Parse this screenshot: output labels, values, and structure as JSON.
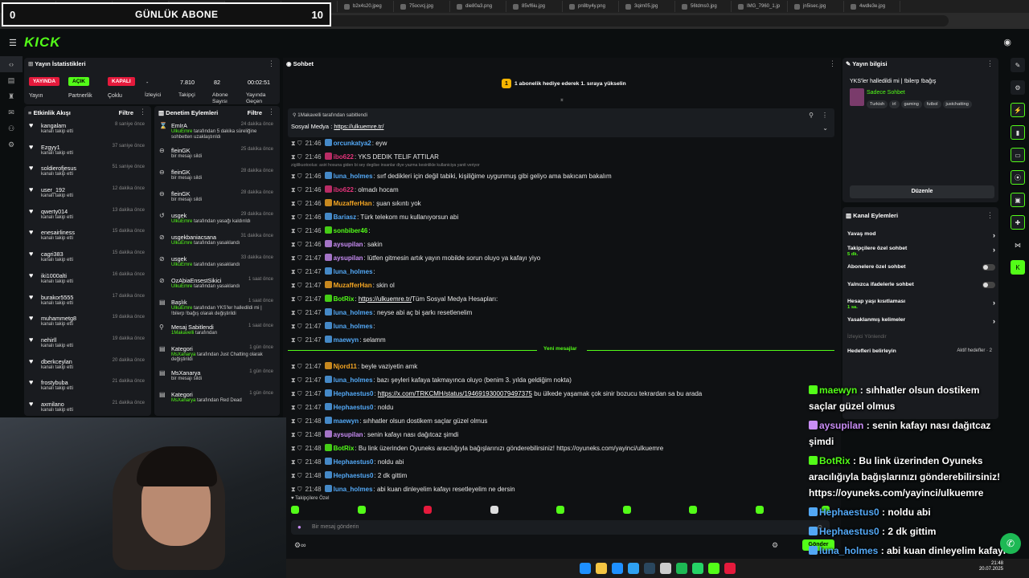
{
  "browser": {
    "tabs": [
      "Vakıflar Ho",
      "bacon i take",
      "KICKSTART",
      "Stream - Kick",
      "Screenshot By",
      "HİZMET",
      "b2x4s20.jpeg",
      "75ocvcj.jpg",
      "die80a3.png",
      "85vf6iu.jpg",
      "pn8by4y.png",
      "3qim05.jpg",
      "56tdms0.jpg",
      "IMG_7960_1.jp",
      "jn5isec.jpg",
      "4wdle3e.jpg"
    ],
    "url": "https://dashboard.kick.com/stream"
  },
  "overlay": {
    "sub_label": "GÜNLÜK ABONE",
    "sub_left": "0",
    "sub_right": "10"
  },
  "logo": "KICK",
  "stats": {
    "title": "Yayın İstatistikleri",
    "items": [
      {
        "pill": "YAYINDA",
        "label": "Yayın",
        "color": "#e51a3c"
      },
      {
        "pill": "AÇIK",
        "label": "Partnerlik",
        "color": "#53fc18"
      },
      {
        "pill": "KAPALI",
        "label": "Çoklu",
        "color": "#e51a3c"
      }
    ],
    "values": [
      {
        "value": "-",
        "label": "İzleyici"
      },
      {
        "value": "7.810",
        "label": "Takipçi"
      },
      {
        "value": "82",
        "label": "Abone Sayısı"
      },
      {
        "value": "00:02:51",
        "label": "Yayında Geçen"
      }
    ]
  },
  "activity": {
    "title": "Etkinlik Akışı",
    "filter": "Filtre",
    "items": [
      {
        "name": "kangalam",
        "sub": "kanalı takip etti",
        "time": "8 saniye önce"
      },
      {
        "name": "Ezgyy1",
        "sub": "kanalı takip etti",
        "time": "37 saniye önce"
      },
      {
        "name": "soldierofjesus",
        "sub": "kanalı takip etti",
        "time": "51 saniye önce"
      },
      {
        "name": "user_192",
        "sub": "kanalı takip etti",
        "time": "12 dakika önce"
      },
      {
        "name": "qwerty014",
        "sub": "kanalı takip etti",
        "time": "13 dakika önce"
      },
      {
        "name": "enesairliness",
        "sub": "kanalı takip etti",
        "time": "15 dakika önce"
      },
      {
        "name": "cagri383",
        "sub": "kanalı takip etti",
        "time": "15 dakika önce"
      },
      {
        "name": "iki1000alti",
        "sub": "kanalı takip etti",
        "time": "16 dakika önce"
      },
      {
        "name": "burakor5555",
        "sub": "kanalı takip etti",
        "time": "17 dakika önce"
      },
      {
        "name": "muhammetg8",
        "sub": "kanalı takip etti",
        "time": "19 dakika önce"
      },
      {
        "name": "nehirll",
        "sub": "kanalı takip etti",
        "time": "19 dakika önce"
      },
      {
        "name": "dberkceylan",
        "sub": "kanalı takip etti",
        "time": "20 dakika önce"
      },
      {
        "name": "frostybuba",
        "sub": "kanalı takip etti",
        "time": "21 dakika önce"
      },
      {
        "name": "axmilano",
        "sub": "kanalı takip etti",
        "time": "21 dakika önce"
      }
    ]
  },
  "modlog": {
    "title": "Denetim Eylemleri",
    "filter": "Filtre",
    "items": [
      {
        "icon": "⌛",
        "name": "EmIrA",
        "sub": "UlkuEmre tarafından 5 dakika süreliğine sohbetten uzaklaştırıldı",
        "time": "24 dakika önce"
      },
      {
        "icon": "⊖",
        "name": "fleinGK",
        "sub": "bir mesajı sildi",
        "time": "25 dakika önce"
      },
      {
        "icon": "⊖",
        "name": "fleinGK",
        "sub": "bir mesajı sildi",
        "time": "28 dakika önce"
      },
      {
        "icon": "⊖",
        "name": "fleinGK",
        "sub": "bir mesajı sildi",
        "time": "28 dakika önce"
      },
      {
        "icon": "↺",
        "name": "usgek",
        "sub": "UlkuEmre tarafından yasağı kaldırıldı",
        "time": "29 dakika önce"
      },
      {
        "icon": "⊘",
        "name": "usgekbaniacsana",
        "sub": "UlkuEmre tarafından yasaklandı",
        "time": "31 dakika önce"
      },
      {
        "icon": "⊘",
        "name": "usgek",
        "sub": "UlkuEmre tarafından yasaklandı",
        "time": "33 dakika önce"
      },
      {
        "icon": "⊘",
        "name": "OzAbiaEnsestSikici",
        "sub": "UlkuEmre tarafından yasaklandı",
        "time": "1 saat önce"
      },
      {
        "icon": "▤",
        "name": "Başlık",
        "sub": "UlkuEmre tarafından YKS'ler halledildi mi | !bilerp !bağış olarak değiştirildi",
        "time": "1 saat önce"
      },
      {
        "icon": "⚲",
        "name": "Mesaj Sabitlendi",
        "sub": "1Makavelli tarafından",
        "time": "1 saat önce"
      },
      {
        "icon": "▤",
        "name": "Kategori",
        "sub": "MsXanarya tarafından Just Chatting olarak değiştirildi",
        "time": "1 gün önce"
      },
      {
        "icon": "▤",
        "name": "MsXanarya",
        "sub": "bir mesajı sildi",
        "time": "1 gün önce"
      },
      {
        "icon": "▤",
        "name": "Kategori",
        "sub": "MsXanarya tarafından Red Dead",
        "time": "1 gün önce"
      }
    ]
  },
  "chat": {
    "title": "Sohbet",
    "goal": "1 abonelik hediye ederek 1. sıraya yükselin",
    "pinned_by": "1Makavelli tarafından sabitlendi",
    "pinned_text": "Sosyal Medya : ",
    "pinned_link": "https://ulkuemre.tr/",
    "new_messages": "Yeni mesajlar",
    "input_placeholder": "Bir mesaj gönderin",
    "send": "Gönder",
    "follower_only": "Takipçilere Özel",
    "messages": [
      {
        "time": "21:46",
        "user": "orcunkatya2",
        "color": "#53a8f5",
        "text": "eyw"
      },
      {
        "time": "21:46",
        "user": "ibo622",
        "color": "#e3337a",
        "text": "YKS DEDIK TELIF ATTILAR"
      },
      {
        "time": "21:46",
        "user": "luna_holmes",
        "color": "#53a8f5",
        "text": "sırf dedikleri için değil tabiki, kişiliğime uygunmuş gibi geliyo ama bakıcam bakalım"
      },
      {
        "time": "21:46",
        "user": "ibo622",
        "color": "#e3337a",
        "text": "olmadı hocam"
      },
      {
        "time": "21:46",
        "user": "MuzafferHan",
        "color": "#f5a623",
        "text": "şuan sıkıntı yok"
      },
      {
        "time": "21:46",
        "user": "Bariasz",
        "color": "#53a8f5",
        "text": "Türk telekom mu kullanıyorsun abi"
      },
      {
        "time": "21:46",
        "user": "sonbiber46",
        "color": "#53fc18",
        "text": ""
      },
      {
        "time": "21:46",
        "user": "aysupilan",
        "color": "#c98df5",
        "text": "sakin"
      },
      {
        "time": "21:47",
        "user": "aysupilan",
        "color": "#c98df5",
        "text": "lütfen gitmesin artık yayın mobilde sorun oluyo ya kafayı yiyo"
      },
      {
        "time": "21:47",
        "user": "luna_holmes",
        "color": "#53a8f5",
        "text": ""
      },
      {
        "time": "21:47",
        "user": "MuzafferHan",
        "color": "#f5a623",
        "text": "skin ol"
      },
      {
        "time": "21:47",
        "user": "BotRix",
        "color": "#53fc18",
        "text": "Tüm Sosyal Medya Hesapları: ",
        "link": "https://ulkuemre.tr/"
      },
      {
        "time": "21:47",
        "user": "luna_holmes",
        "color": "#53a8f5",
        "text": "neyse abi aç bi şarkı resetlenelim"
      },
      {
        "time": "21:47",
        "user": "luna_holmes",
        "color": "#53a8f5",
        "text": ""
      },
      {
        "time": "21:47",
        "user": "maewyn",
        "color": "#53a8f5",
        "text": "selamm"
      },
      {
        "time": "21:47",
        "user": "Njord11",
        "color": "#f5a623",
        "text": "beyle vaziyetin amk"
      },
      {
        "time": "21:47",
        "user": "luna_holmes",
        "color": "#53a8f5",
        "text": "bazı şeyleri kafaya takmayınca oluyo (benim 3. yılda geldiğim nokta)"
      },
      {
        "time": "21:47",
        "user": "Hephaestus0",
        "color": "#53a8f5",
        "link": "https://x.com/TRKCMH/status/1946919300079497375",
        "text": " bu ülkede yaşamak çok sinir bozucu tekrardan sa bu arada"
      },
      {
        "time": "21:47",
        "user": "Hephaestus0",
        "color": "#53a8f5",
        "text": "noldu"
      },
      {
        "time": "21:48",
        "user": "maewyn",
        "color": "#53a8f5",
        "text": "sıhhatler olsun dostikem saçlar güzel olmus"
      },
      {
        "time": "21:48",
        "user": "aysupilan",
        "color": "#c98df5",
        "text": "senin kafayı nası dağıtcaz şimdi"
      },
      {
        "time": "21:48",
        "user": "BotRix",
        "color": "#53fc18",
        "text": "Bu link üzerinden Oyuneks aracılığıyla bağışlarınızı gönderebilirsiniz! https://oyuneks.com/yayinci/ulkuemre"
      },
      {
        "time": "21:48",
        "user": "Hephaestus0",
        "color": "#53a8f5",
        "text": "noldu abi"
      },
      {
        "time": "21:48",
        "user": "Hephaestus0",
        "color": "#53a8f5",
        "text": "2 dk gittim"
      },
      {
        "time": "21:48",
        "user": "luna_holmes",
        "color": "#53a8f5",
        "text": "abi kuan dinleyelim kafayı resetleyelim ne dersin"
      }
    ],
    "warning": "ziglilkuotoolus: asiri hosuna giden bi sey degilse insanlar diye yazma kesinlikle kullaniciya yanit veriyor"
  },
  "info": {
    "title": "Yayın bilgisi",
    "stream_title": "YKS'ler halledildi mi | !bilerp !bağış",
    "category": "Sadece Sohbet",
    "tags": [
      "Turkish",
      "irl",
      "gaming",
      "futbol",
      "justchatting"
    ],
    "edit": "Düzenle"
  },
  "actions": {
    "title": "Kanal Eylemleri",
    "rows": [
      {
        "label": "Yavaş mod",
        "sub": "",
        "ctl": "›"
      },
      {
        "label": "Takipçilere özel sohbet",
        "sub": "5 dk.",
        "ctl": "›"
      },
      {
        "label": "Abonelere özel sohbet",
        "sub": "",
        "ctl": "toggle"
      },
      {
        "label": "Yalnızca ifadelerle sohbet",
        "sub": "",
        "ctl": "toggle"
      },
      {
        "label": "Hesap yaşı kısıtlaması",
        "sub": "1 sa.",
        "ctl": "›"
      },
      {
        "label": "Yasaklanmış kelimeler",
        "sub": "",
        "ctl": "›"
      }
    ],
    "viewer_direct": "İzleyici Yönlendir",
    "goals": "Hedefleri belirleyin",
    "goals_status": "Aktif hedefler · 2"
  },
  "overlay_chat": [
    {
      "user": "maewyn",
      "color": "#53fc18",
      "text": " : sıhhatler olsun dostikem"
    },
    {
      "user": "",
      "color": "#fff",
      "text": "saçlar güzel olmus"
    },
    {
      "user": "aysupilan",
      "color": "#c98df5",
      "text": " : senin kafayı nası dağıtcaz"
    },
    {
      "user": "",
      "color": "#fff",
      "text": "şimdi"
    },
    {
      "user": "BotRix",
      "color": "#53fc18",
      "text": " : Bu link üzerinden Oyuneks"
    },
    {
      "user": "",
      "color": "#fff",
      "text": "aracılığıyla bağışlarınızı gönderebilirsiniz!"
    },
    {
      "user": "",
      "color": "#fff",
      "text": "https://oyuneks.com/yayinci/ulkuemre"
    },
    {
      "user": "Hephaestus0",
      "color": "#53a8f5",
      "text": " : noldu abi"
    },
    {
      "user": "Hephaestus0",
      "color": "#53a8f5",
      "text": " : 2 dk gittim"
    },
    {
      "user": "luna_holmes",
      "color": "#53a8f5",
      "text": " : abi kuan dinleyelim kafayı"
    },
    {
      "user": "",
      "color": "#fff",
      "text": "resetleyelim ne dersin"
    }
  ],
  "clock": {
    "time": "21:48",
    "date": "20.07.2025"
  }
}
